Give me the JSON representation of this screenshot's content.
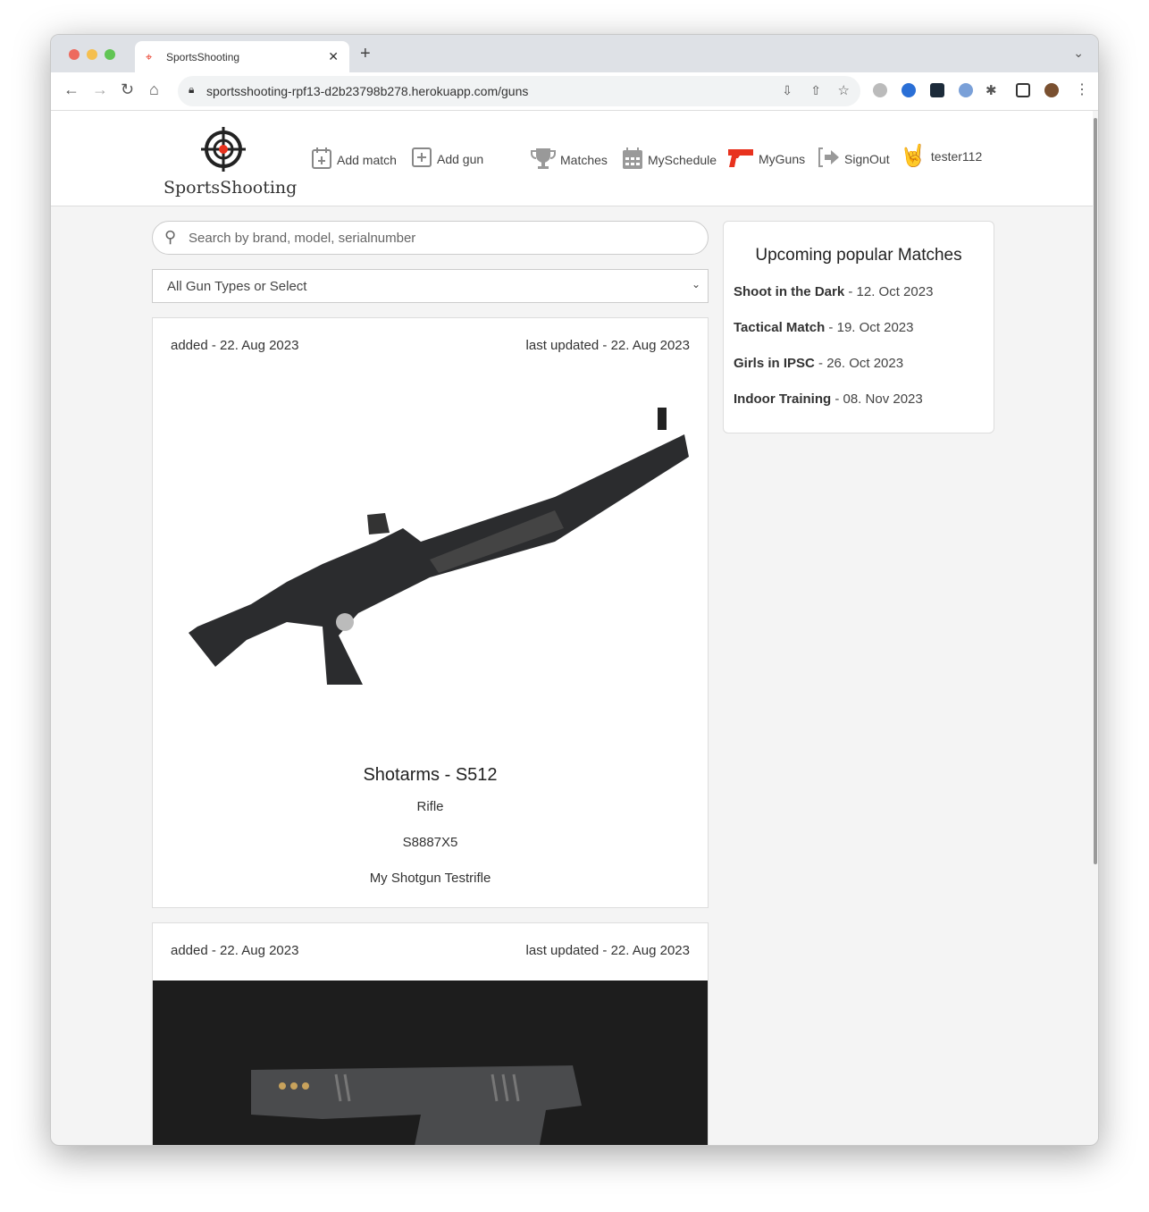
{
  "browser": {
    "tab_title": "SportsShooting",
    "url": "sportsshooting-rpf13-d2b23798b278.herokuapp.com/guns"
  },
  "header": {
    "logo_text": "SportsShooting",
    "nav": {
      "add_match": "Add match",
      "add_gun": "Add gun",
      "matches": "Matches",
      "myschedule": "MySchedule",
      "myguns": "MyGuns",
      "signout": "SignOut",
      "user": "tester112"
    }
  },
  "search": {
    "placeholder": "Search by brand, model, serialnumber"
  },
  "filter": {
    "selected": "All Gun Types or Select"
  },
  "guns": [
    {
      "added": "added - 22. Aug 2023",
      "updated": "last updated - 22. Aug 2023",
      "title": "Shotarms - S512",
      "type": "Rifle",
      "serial": "S8887X5",
      "description": "My Shotgun Testrifle"
    },
    {
      "added": "added - 22. Aug 2023",
      "updated": "last updated - 22. Aug 2023"
    }
  ],
  "sidebar": {
    "title": "Upcoming popular Matches",
    "matches": [
      {
        "name": "Shoot in the Dark",
        "date": " - 12. Oct 2023"
      },
      {
        "name": "Tactical Match",
        "date": " - 19. Oct 2023"
      },
      {
        "name": "Girls in IPSC",
        "date": " - 26. Oct 2023"
      },
      {
        "name": "Indoor Training",
        "date": " - 08. Nov 2023"
      }
    ]
  },
  "colors": {
    "accent": "#e8321e",
    "page_bg": "#f4f4f4"
  }
}
